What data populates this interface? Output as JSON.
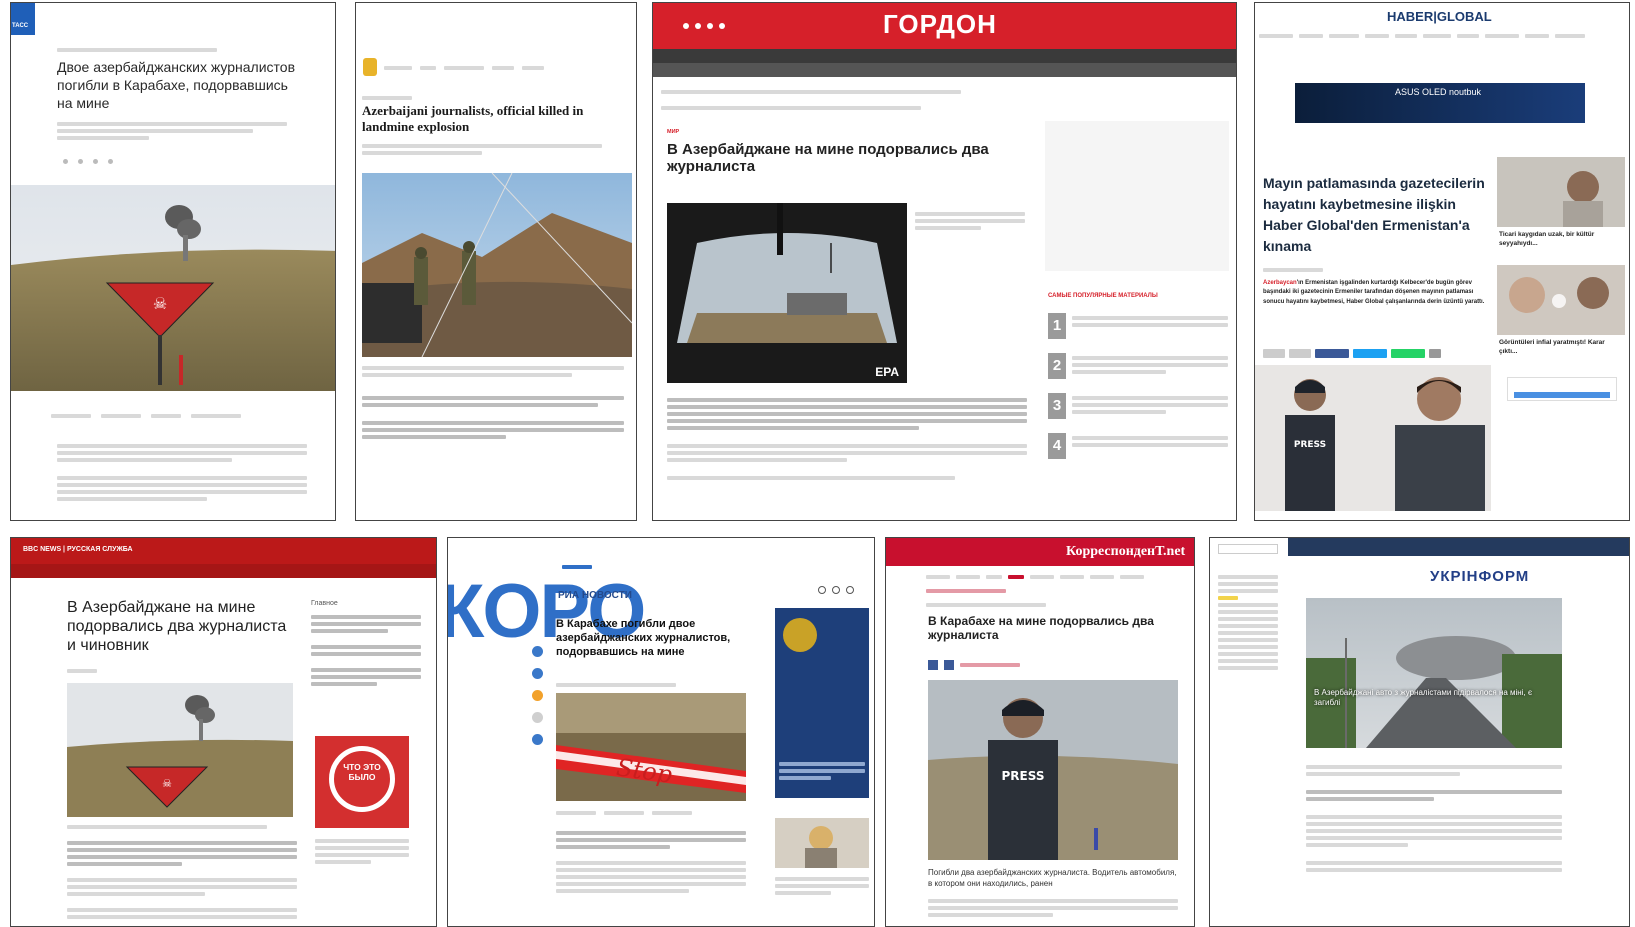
{
  "tass": {
    "logo": "ТАСС",
    "title": "Двое азербайджанских журналистов погибли в Карабахе, подорвавшись на мине"
  },
  "mirage": {
    "title": "Azerbaijani journalists, official killed in landmine explosion"
  },
  "gordon": {
    "logo": "ГОРДОН",
    "rubric": "МИР",
    "title": "В Азербайджане на мине подорвались два журналиста",
    "photo_badge": "EPA",
    "popular_heading": "САМЫЕ ПОПУЛЯРНЫЕ МАТЕРИАЛЫ",
    "popular_numbers": [
      "1",
      "2",
      "3",
      "4"
    ]
  },
  "haber": {
    "logo": "HABER|GLOBAL",
    "ad_text": "ASUS OLED noutbuk",
    "title": "Mayın patlamasında gazetecilerin hayatını kaybetmesine ilişkin Haber Global'den Ermenistan'a kınama",
    "lead_red": "Azerbaycan",
    "lead": "'ın Ermenistan işgalinden kurtardığı Kelbecer'de bugün görev başındaki iki gazetecinin Ermeniler tarafından döşenen mayının patlaması sonucu hayatını kaybetmesi, Haber Global çalışanlarında derin üzüntü yarattı.",
    "side_caption_1": "Ticari kaygıdan uzak, bir kültür seyyahıydı...",
    "side_caption_2": "Görüntüleri infial yaratmıştı! Karar çıktı...",
    "vest_text": "PRESS"
  },
  "bbc": {
    "header": "BBC NEWS | РУССКАЯ СЛУЖБА",
    "title": "В Азербайджане на мине подорвались два журналиста и чиновник",
    "sidebar_heading": "Главное",
    "card_text": "ЧТО ЭТО БЫЛО"
  },
  "ria": {
    "bg_text": "КОРО",
    "logo": "РИА НОВОСТИ",
    "title": "В Карабахе погибли двое азербайджанских журналистов, подорвавшись на мине",
    "stop_text": "Stop"
  },
  "korr": {
    "logo": "КорреспонденТ.net",
    "title": "В Карабахе на мине подорвались два журналиста",
    "vest_text": "PRESS",
    "caption": "Погибли два азербайджанских журналиста. Водитель автомобиля, в котором они находились, ранен"
  },
  "ukr": {
    "logo": "УКРІНФОРМ",
    "caption": "В Азербайджані авто з журналістами підірвалося на міні, є загиблі"
  },
  "colors": {
    "gordon_red": "#d6202a",
    "bbc_red": "#bb1919",
    "tass_blue": "#1f5fb8",
    "ukr_navy": "#243a5e"
  }
}
